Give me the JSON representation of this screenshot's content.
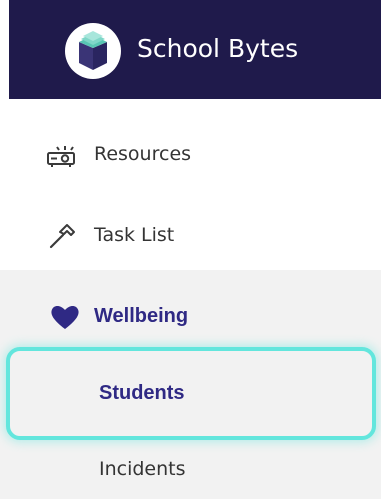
{
  "brand": {
    "name": "School Bytes",
    "logo_icon": "book-logo-icon"
  },
  "nav": {
    "items": [
      {
        "label": "Resources",
        "icon": "projector-icon"
      },
      {
        "label": "Task List",
        "icon": "hammer-icon"
      },
      {
        "label": "Wellbeing",
        "icon": "heart-icon",
        "expanded": true
      }
    ],
    "wellbeing_subitems": [
      {
        "label": "Students",
        "selected": true
      },
      {
        "label": "Incidents",
        "selected": false
      }
    ]
  },
  "colors": {
    "brand_bg": "#1f1a4b",
    "active_text": "#2f2984",
    "highlight": "#63e6dd",
    "section_bg": "#f2f2f2"
  }
}
